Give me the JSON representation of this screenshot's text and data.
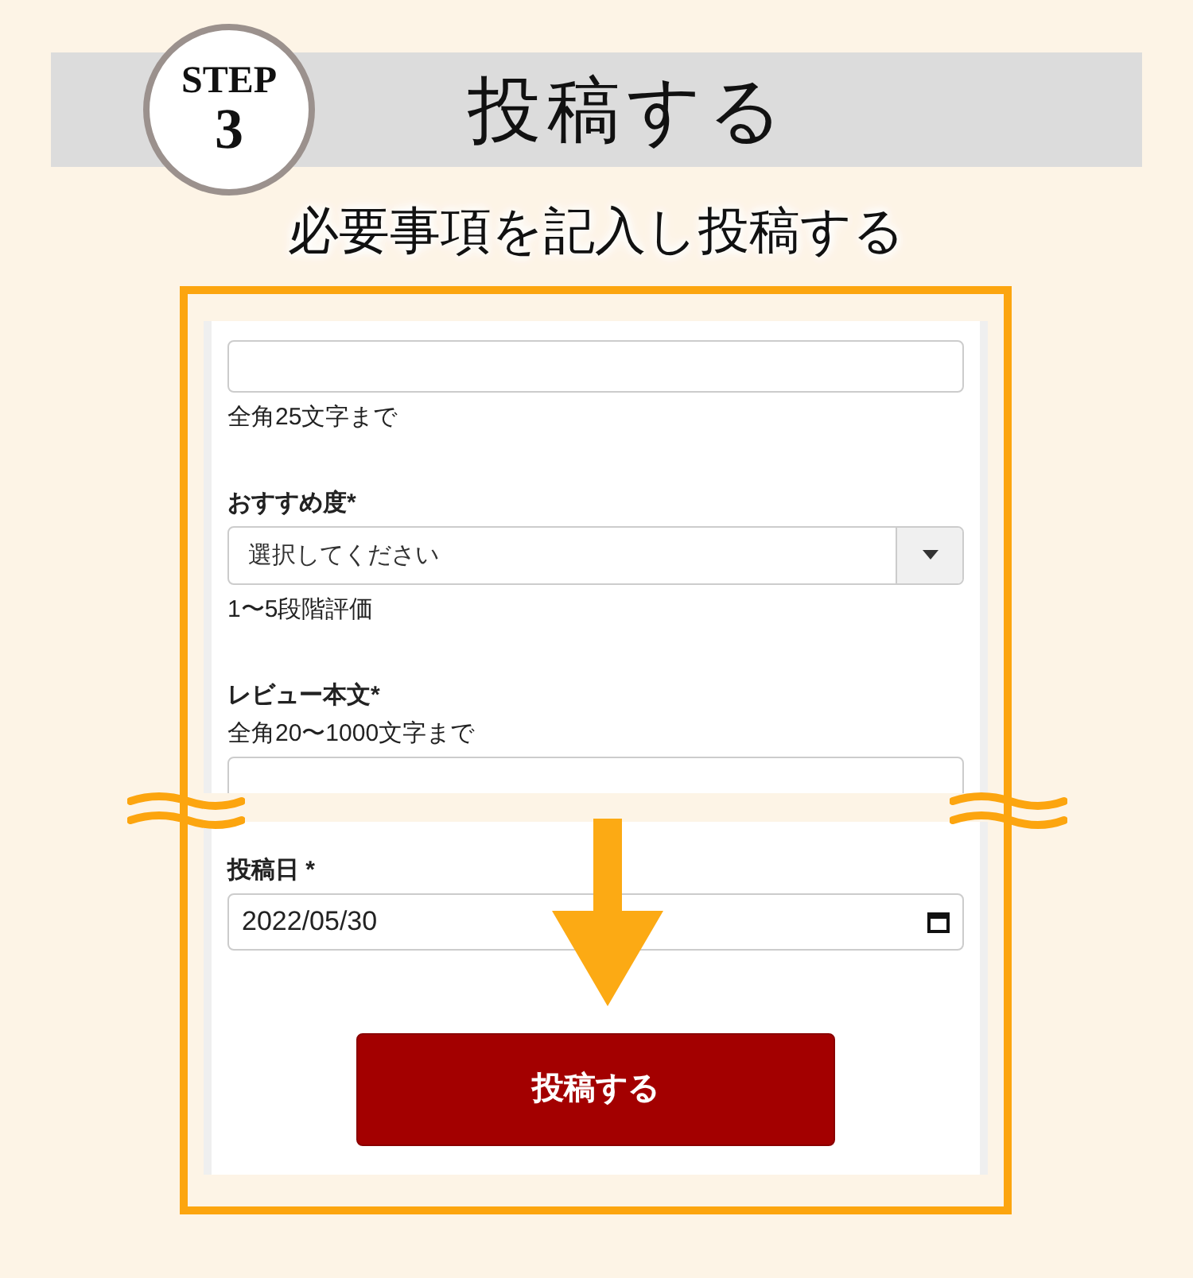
{
  "step": {
    "label": "STEP",
    "number": "3"
  },
  "title": "投稿する",
  "subtitle": "必要事項を記入し投稿する",
  "sections": [
    {
      "fields": [
        {
          "kind": "text",
          "help": "全角25文字まで"
        },
        {
          "kind": "select",
          "label": "おすすめ度*",
          "placeholder": "選択してください",
          "help": "1〜5段階評価"
        },
        {
          "kind": "textarea",
          "label": "レビュー本文*",
          "help": "全角20〜1000文字まで"
        }
      ]
    },
    {
      "fields": [
        {
          "kind": "date",
          "label": "投稿日 *",
          "value": "2022/05/30"
        }
      ]
    }
  ],
  "submit": "投稿する"
}
